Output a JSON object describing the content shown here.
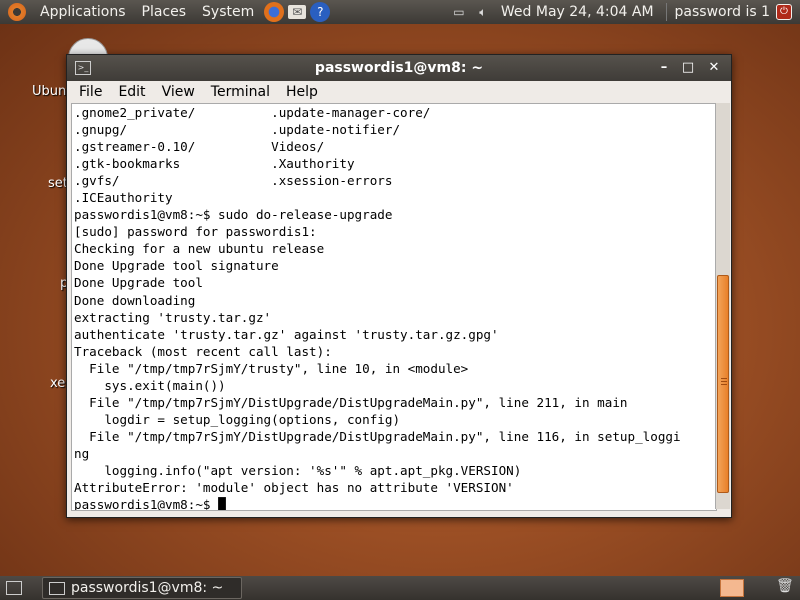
{
  "top_panel": {
    "menus": [
      "Applications",
      "Places",
      "System"
    ],
    "launchers": [
      "firefox-icon",
      "mail-icon",
      "help-icon"
    ],
    "datetime": "Wed May 24,  4:04 AM",
    "user": "password is 1"
  },
  "desktop": {
    "labels": [
      "Ubun",
      "set",
      "p",
      "xe"
    ]
  },
  "window": {
    "title": "passwordis1@vm8: ~",
    "menu": [
      "File",
      "Edit",
      "View",
      "Terminal",
      "Help"
    ],
    "lines": [
      ".gnome2_private/          .update-manager-core/",
      ".gnupg/                   .update-notifier/",
      ".gstreamer-0.10/          Videos/",
      ".gtk-bookmarks            .Xauthority",
      ".gvfs/                    .xsession-errors",
      ".ICEauthority",
      "passwordis1@vm8:~$ sudo do-release-upgrade",
      "[sudo] password for passwordis1:",
      "Checking for a new ubuntu release",
      "Done Upgrade tool signature",
      "Done Upgrade tool",
      "Done downloading",
      "extracting 'trusty.tar.gz'",
      "authenticate 'trusty.tar.gz' against 'trusty.tar.gz.gpg'",
      "Traceback (most recent call last):",
      "  File \"/tmp/tmp7rSjmY/trusty\", line 10, in <module>",
      "    sys.exit(main())",
      "  File \"/tmp/tmp7rSjmY/DistUpgrade/DistUpgradeMain.py\", line 211, in main",
      "    logdir = setup_logging(options, config)",
      "  File \"/tmp/tmp7rSjmY/DistUpgrade/DistUpgradeMain.py\", line 116, in setup_loggi",
      "ng",
      "    logging.info(\"apt version: '%s'\" % apt.apt_pkg.VERSION)",
      "AttributeError: 'module' object has no attribute 'VERSION'",
      "passwordis1@vm8:~$ "
    ]
  },
  "bottom_panel": {
    "task_label": "passwordis1@vm8: ~"
  }
}
